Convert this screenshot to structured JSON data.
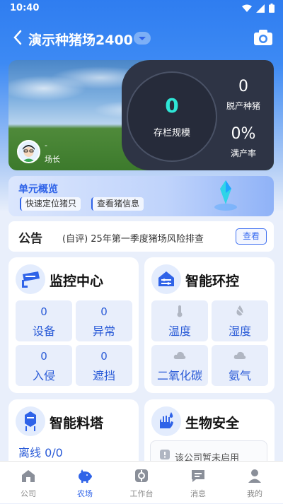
{
  "status_bar": {
    "time": "10:40"
  },
  "header": {
    "farm_name": "演示种猪场2400"
  },
  "hero": {
    "inventory_value": "0",
    "inventory_label": "存栏规模",
    "culled_value": "0",
    "culled_label": "脱产种猪",
    "full_rate_value": "0%",
    "full_rate_label": "满产率",
    "manager_name": "-",
    "manager_role": "场长"
  },
  "unit_overview": {
    "title": "单元概览",
    "quick_locate_label": "快速定位猪只",
    "view_pig_info_label": "查看猪信息"
  },
  "notice": {
    "title": "公告",
    "text": "(自评) 25年第一季度猪场风险排查",
    "view_label": "查看"
  },
  "monitor": {
    "title": "监控中心",
    "tiles": [
      {
        "value": "0",
        "label": "设备"
      },
      {
        "value": "0",
        "label": "异常"
      },
      {
        "value": "0",
        "label": "入侵"
      },
      {
        "value": "0",
        "label": "遮挡"
      }
    ]
  },
  "env_control": {
    "title": "智能环控",
    "tiles": [
      {
        "icon": "thermometer-icon",
        "label": "温度"
      },
      {
        "icon": "humidity-icon",
        "label": "湿度"
      },
      {
        "icon": "cloud-icon",
        "label": "二氧化碳"
      },
      {
        "icon": "cloud-icon",
        "label": "氨气"
      }
    ]
  },
  "feed_tower": {
    "title": "智能料塔",
    "offline_text": "离线 0/0"
  },
  "biosecurity": {
    "title": "生物安全",
    "notice_text": "该公司暂未启用"
  },
  "tabbar": {
    "items": [
      {
        "label": "公司",
        "icon": "home-icon"
      },
      {
        "label": "农场",
        "icon": "pig-icon"
      },
      {
        "label": "工作台",
        "icon": "workbench-icon"
      },
      {
        "label": "消息",
        "icon": "message-icon"
      },
      {
        "label": "我的",
        "icon": "person-icon"
      }
    ],
    "active_index": 1
  },
  "colors": {
    "primary": "#2f63e8",
    "accent_cyan": "#2ee6d6",
    "dark_panel": "#2e3445"
  }
}
